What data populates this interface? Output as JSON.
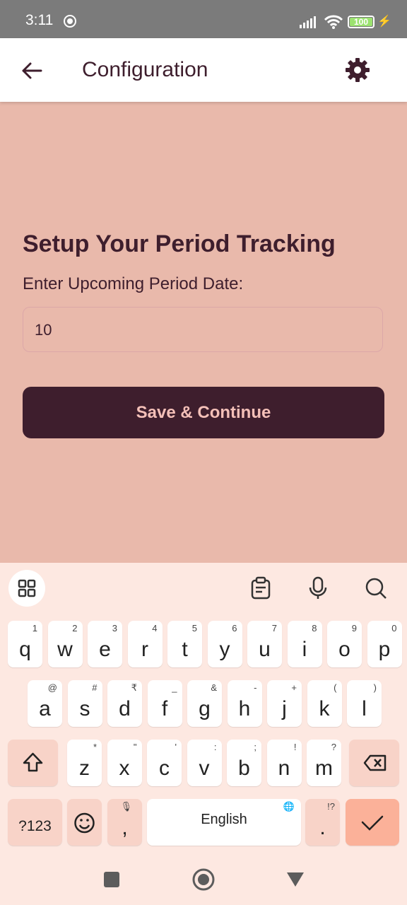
{
  "status": {
    "time": "3:11",
    "battery": "100"
  },
  "appbar": {
    "title": "Configuration",
    "back_icon": "arrow-left-icon",
    "settings_icon": "gear-icon"
  },
  "main": {
    "heading": "Setup Your Period Tracking",
    "label": "Enter Upcoming Period Date:",
    "input_value": "10",
    "save_button": "Save & Continue"
  },
  "colors": {
    "background": "#e9b9ab",
    "primary": "#3e1e2d",
    "button_text": "#f4c0b8",
    "keyboard_bg": "#fde8e1"
  },
  "keyboard": {
    "row1": [
      {
        "k": "q",
        "s": "1"
      },
      {
        "k": "w",
        "s": "2"
      },
      {
        "k": "e",
        "s": "3"
      },
      {
        "k": "r",
        "s": "4"
      },
      {
        "k": "t",
        "s": "5"
      },
      {
        "k": "y",
        "s": "6"
      },
      {
        "k": "u",
        "s": "7"
      },
      {
        "k": "i",
        "s": "8"
      },
      {
        "k": "o",
        "s": "9"
      },
      {
        "k": "p",
        "s": "0"
      }
    ],
    "row2": [
      {
        "k": "a",
        "s": "@"
      },
      {
        "k": "s",
        "s": "#"
      },
      {
        "k": "d",
        "s": "₹"
      },
      {
        "k": "f",
        "s": "_"
      },
      {
        "k": "g",
        "s": "&"
      },
      {
        "k": "h",
        "s": "-"
      },
      {
        "k": "j",
        "s": "+"
      },
      {
        "k": "k",
        "s": "("
      },
      {
        "k": "l",
        "s": ")"
      }
    ],
    "row3": [
      {
        "k": "z",
        "s": "*"
      },
      {
        "k": "x",
        "s": "\""
      },
      {
        "k": "c",
        "s": "'"
      },
      {
        "k": "v",
        "s": ":"
      },
      {
        "k": "b",
        "s": ";"
      },
      {
        "k": "n",
        "s": "!"
      },
      {
        "k": "m",
        "s": "?"
      }
    ],
    "symbols_key": "?123",
    "comma_key": ",",
    "space_label": "English",
    "period_key": ".",
    "period_sub": "!?"
  }
}
